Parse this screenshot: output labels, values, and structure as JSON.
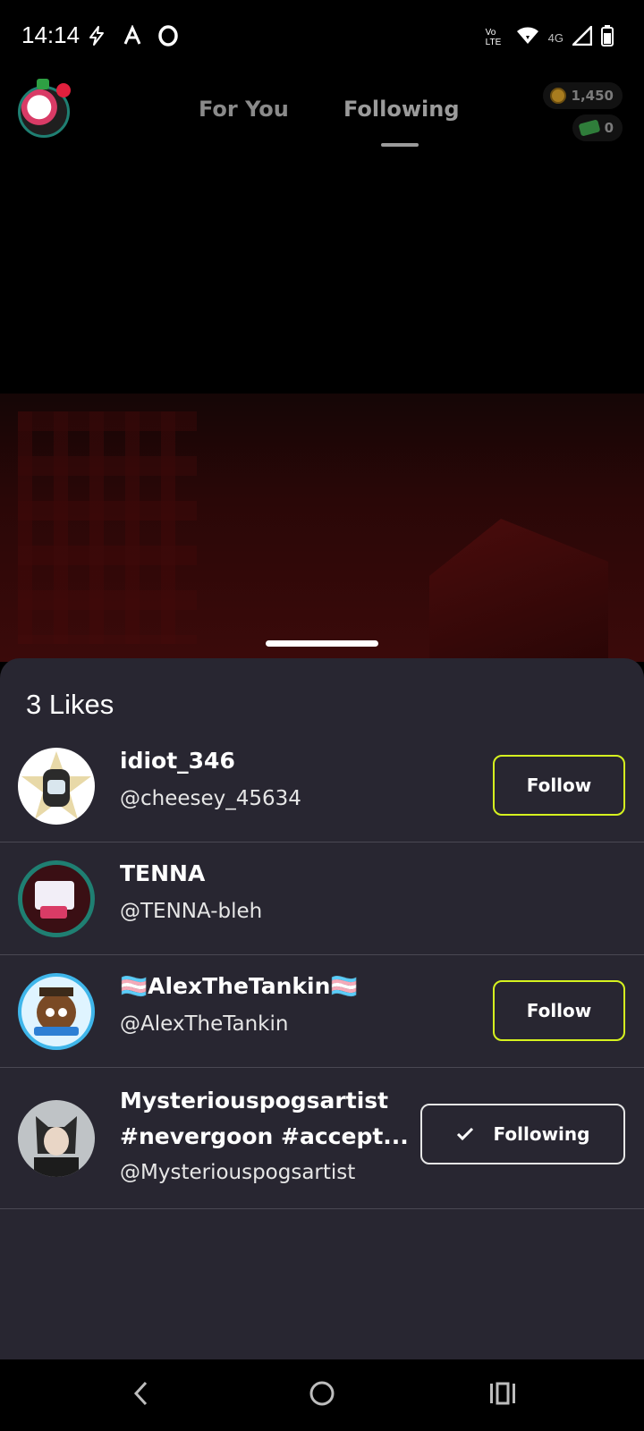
{
  "status_bar": {
    "time": "14:14",
    "network_label": "Vo LTE",
    "network_type": "4G"
  },
  "header": {
    "tabs": [
      {
        "label": "For You",
        "active": false
      },
      {
        "label": "Following",
        "active": true
      }
    ],
    "coins": "1,450",
    "cash": "0"
  },
  "likes_sheet": {
    "title": "3 Likes",
    "users": [
      {
        "display_name": "idiot_346",
        "handle": "@cheesey_45634",
        "action": "Follow"
      },
      {
        "display_name": "TENNA",
        "handle": "@TENNA-bleh",
        "action": ""
      },
      {
        "display_name": "🏳️‍⚧️AlexTheTankin🏳️‍⚧️",
        "handle": "@AlexTheTankin",
        "action": "Follow"
      },
      {
        "display_name": "Mysteriouspogsartist",
        "display_name_line2": "#nevergoon #accept...",
        "handle": "@Mysteriouspogsartist",
        "action": "Following"
      }
    ]
  },
  "colors": {
    "sheet_bg": "#282631",
    "follow_border": "#d6f21f",
    "following_border": "#e6e6e6"
  }
}
